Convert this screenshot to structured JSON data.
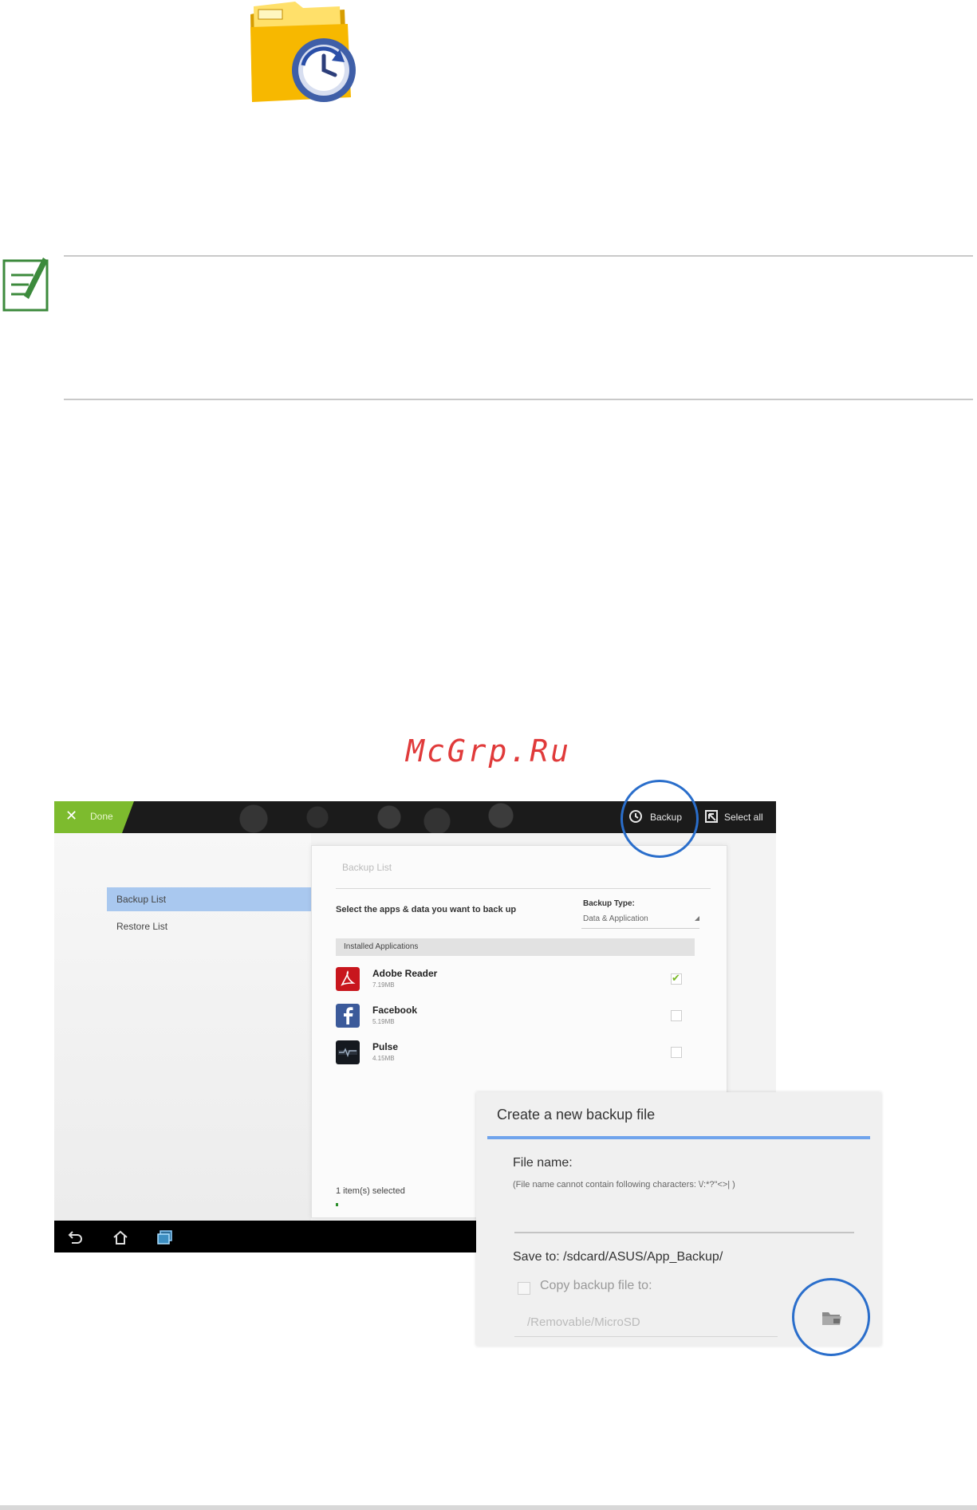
{
  "watermark": "McGrp.Ru",
  "tablet": {
    "topbar": {
      "done_label": "Done",
      "backup_label": "Backup",
      "select_all_label": "Select all"
    },
    "nav": {
      "items": [
        {
          "label": "Backup List"
        },
        {
          "label": "Restore List"
        }
      ]
    },
    "panel": {
      "title": "Backup List",
      "prompt": "Select the apps & data you want to back up",
      "backup_type_label": "Backup Type:",
      "backup_type_value": "Data & Application",
      "installed_header": "Installed Applications",
      "apps": [
        {
          "name": "Adobe Reader",
          "size": "7.19MB",
          "checked": true
        },
        {
          "name": "Facebook",
          "size": "5.19MB",
          "checked": false
        },
        {
          "name": "Pulse",
          "size": "4.15MB",
          "checked": false
        }
      ],
      "status": "1 item(s) selected"
    }
  },
  "dialog": {
    "title": "Create a new backup file",
    "file_name_label": "File name:",
    "file_name_hint": "(File name cannot contain following characters: \\/:*?\"<>| )",
    "save_to": "Save to:  /sdcard/ASUS/App_Backup/",
    "copy_label": "Copy backup file to:",
    "copy_path": "/Removable/MicroSD"
  },
  "colors": {
    "accent_green": "#7dbb2e",
    "highlight_blue": "#a9c8ef",
    "circle_blue": "#2a6ecb",
    "dialog_accent": "#70a4ec",
    "watermark_red": "#e03a3a"
  }
}
